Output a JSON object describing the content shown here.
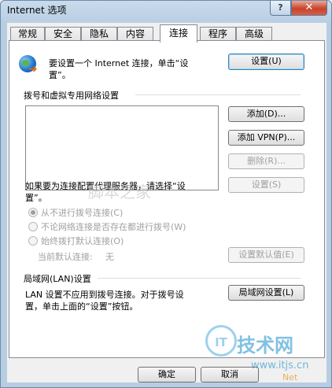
{
  "window": {
    "title": "Internet 选项",
    "help_label": "?",
    "close_label": "✕"
  },
  "tabs": [
    "常规",
    "安全",
    "隐私",
    "内容",
    "连接",
    "程序",
    "高级"
  ],
  "active_tab": "连接",
  "setup": {
    "text_line1": "要设置一个 Internet 连接，单击“设",
    "text_line2": "置”。",
    "button": "设置(U)"
  },
  "dialup": {
    "heading": "拨号和虚拟专用网络设置",
    "add_button": "添加(D)...",
    "add_vpn_button": "添加 VPN(P)...",
    "delete_button": "删除(R)...",
    "proxy_text_line1": "如果要为连接配置代理服务器，请选择“设",
    "proxy_text_line2": "置”。",
    "settings_button": "设置(S)",
    "options": [
      "从不进行拨号连接(C)",
      "不论网络连接是否存在都进行拨号(W)",
      "始终拨打默认连接(O)"
    ],
    "default_label": "当前默认连接:",
    "default_value": "无",
    "set_default_button": "设置默认值(E)"
  },
  "lan": {
    "heading": "局域网(LAN)设置",
    "text_line1": "LAN 设置不应用到拨号连接。对于拨号设",
    "text_line2": "置，单击上面的“设置”按钮。",
    "button": "局域网设置(L)"
  },
  "footer": {
    "ok_button": "确定",
    "cancel_button": "取消"
  },
  "watermark": {
    "logo": "IT",
    "brand": "技术网",
    "url": "www.itjs.cn",
    "mid": "脚本之家",
    "net": "Net"
  }
}
